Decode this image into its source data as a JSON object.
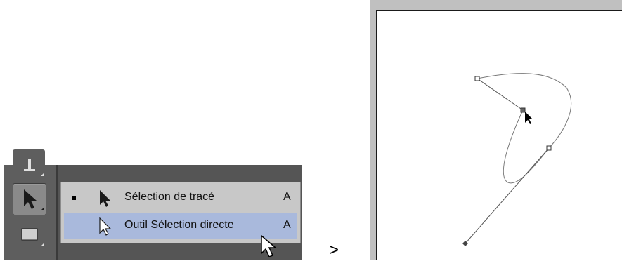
{
  "menu": {
    "items": [
      {
        "label": "Sélection de tracé",
        "shortcut": "A",
        "active": true,
        "icon": "black-arrow-icon"
      },
      {
        "label": "Outil Sélection directe",
        "shortcut": "A",
        "active": false,
        "highlighted": true,
        "icon": "white-arrow-icon"
      }
    ]
  },
  "separator": ">",
  "colors": {
    "panel": "#555555",
    "menu_bg": "#c8c8c8",
    "menu_highlight": "#a9b9dc",
    "canvas_frame": "#c0c0c0"
  }
}
